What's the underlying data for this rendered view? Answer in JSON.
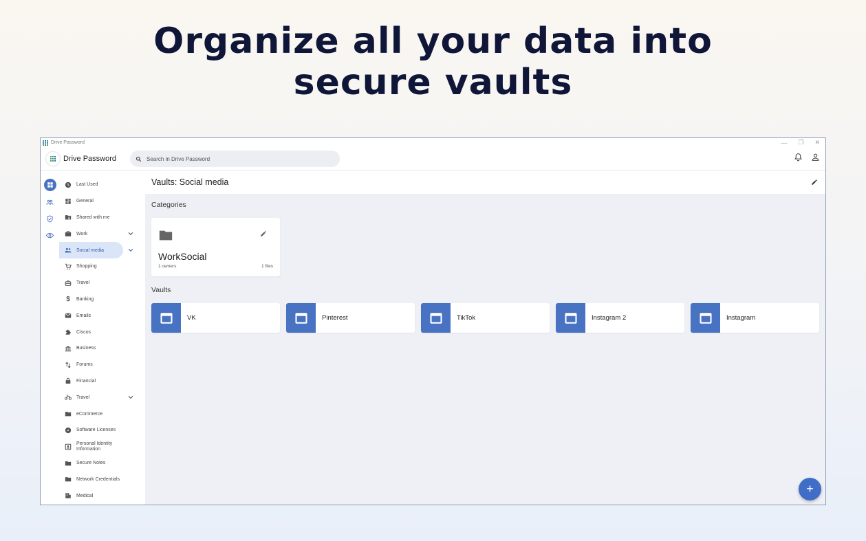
{
  "headline": {
    "line1": "Organize all your data into",
    "line2": "secure vaults"
  },
  "window": {
    "title": "Drive Password",
    "controls": {
      "minimize": "—",
      "restore": "❐",
      "close": "✕"
    }
  },
  "appbar": {
    "brand": "Drive Password",
    "search_placeholder": "Search in Drive Password",
    "icons": [
      "bell-icon",
      "account-icon"
    ]
  },
  "rail": [
    "vaults-icon",
    "shared-icon",
    "security-icon",
    "watch-icon"
  ],
  "sidebar": {
    "items": [
      {
        "label": "Last Used",
        "icon": "clock"
      },
      {
        "label": "General",
        "icon": "dashboard"
      },
      {
        "label": "Shared with me",
        "icon": "folder-shared"
      },
      {
        "label": "Work",
        "icon": "briefcase",
        "expand": true
      },
      {
        "label": "Social media",
        "icon": "people",
        "expand": true,
        "active": true
      },
      {
        "label": "Shopping",
        "icon": "cart"
      },
      {
        "label": "Travel",
        "icon": "luggage"
      },
      {
        "label": "Banking",
        "icon": "dollar"
      },
      {
        "label": "Emails",
        "icon": "mail"
      },
      {
        "label": "Ciscos",
        "icon": "puzzle"
      },
      {
        "label": "Business",
        "icon": "bank"
      },
      {
        "label": "Forums",
        "icon": "swap"
      },
      {
        "label": "Financial",
        "icon": "lock"
      },
      {
        "label": "Travel",
        "icon": "bike",
        "expand": true
      },
      {
        "label": "eCommerce",
        "icon": "folder"
      },
      {
        "label": "Software Licenses",
        "icon": "compass"
      },
      {
        "label": "Personal Identity Information",
        "icon": "id-badge"
      },
      {
        "label": "Secure Notes",
        "icon": "folder"
      },
      {
        "label": "Network Credentials",
        "icon": "folder"
      },
      {
        "label": "Medical",
        "icon": "building"
      }
    ]
  },
  "main": {
    "title": "Vaults: Social media",
    "categories_title": "Categories",
    "category": {
      "name": "WorkSocial",
      "owners": "1 owners",
      "files": "1 files"
    },
    "vaults_title": "Vaults",
    "vaults": [
      "VK",
      "Pinterest",
      "TikTok",
      "Instagram 2",
      "Instagram"
    ],
    "fab": "+"
  },
  "colors": {
    "accent": "#4872c2",
    "headline": "#0f1638",
    "panel": "#eef0f5"
  }
}
